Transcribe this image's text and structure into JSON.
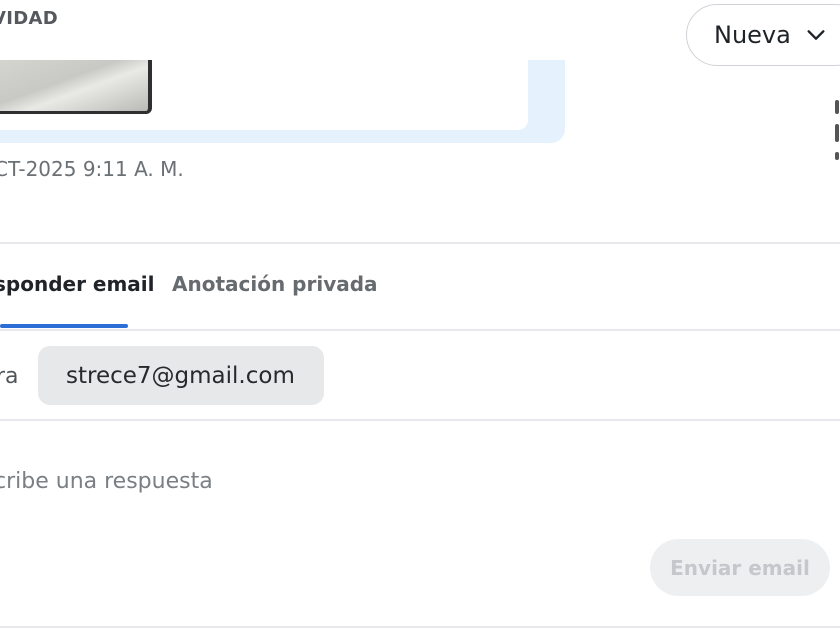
{
  "section": {
    "label": "VIDAD"
  },
  "status_dropdown": {
    "value": "Nueva",
    "icon": "chevron-down-icon"
  },
  "message": {
    "timestamp": "CT-2025 9:11 A. M."
  },
  "composer": {
    "tabs": [
      {
        "label": "sponder email",
        "active": true
      },
      {
        "label": "Anotación privada",
        "active": false
      }
    ],
    "to_label": "ra",
    "recipient": "strece7@gmail.com",
    "placeholder": "cribe una respuesta",
    "send_label": "Enviar email"
  },
  "colors": {
    "accent": "#2b6fd6",
    "message_bg": "#e6f1fe",
    "chip_bg": "#e7e8ea",
    "disabled_button_bg": "#eeeff1"
  }
}
